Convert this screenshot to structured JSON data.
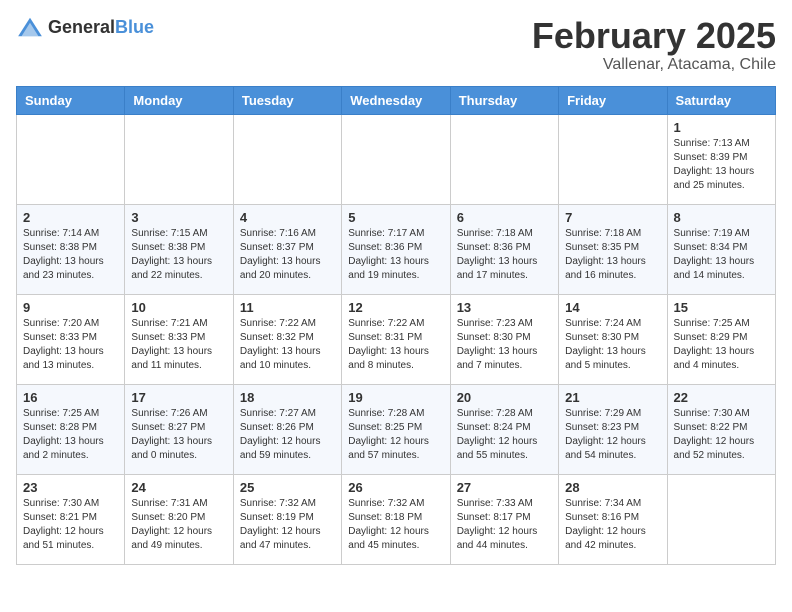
{
  "header": {
    "logo_general": "General",
    "logo_blue": "Blue",
    "month_year": "February 2025",
    "location": "Vallenar, Atacama, Chile"
  },
  "weekdays": [
    "Sunday",
    "Monday",
    "Tuesday",
    "Wednesday",
    "Thursday",
    "Friday",
    "Saturday"
  ],
  "weeks": [
    [
      {
        "day": "",
        "info": ""
      },
      {
        "day": "",
        "info": ""
      },
      {
        "day": "",
        "info": ""
      },
      {
        "day": "",
        "info": ""
      },
      {
        "day": "",
        "info": ""
      },
      {
        "day": "",
        "info": ""
      },
      {
        "day": "1",
        "info": "Sunrise: 7:13 AM\nSunset: 8:39 PM\nDaylight: 13 hours and 25 minutes."
      }
    ],
    [
      {
        "day": "2",
        "info": "Sunrise: 7:14 AM\nSunset: 8:38 PM\nDaylight: 13 hours and 23 minutes."
      },
      {
        "day": "3",
        "info": "Sunrise: 7:15 AM\nSunset: 8:38 PM\nDaylight: 13 hours and 22 minutes."
      },
      {
        "day": "4",
        "info": "Sunrise: 7:16 AM\nSunset: 8:37 PM\nDaylight: 13 hours and 20 minutes."
      },
      {
        "day": "5",
        "info": "Sunrise: 7:17 AM\nSunset: 8:36 PM\nDaylight: 13 hours and 19 minutes."
      },
      {
        "day": "6",
        "info": "Sunrise: 7:18 AM\nSunset: 8:36 PM\nDaylight: 13 hours and 17 minutes."
      },
      {
        "day": "7",
        "info": "Sunrise: 7:18 AM\nSunset: 8:35 PM\nDaylight: 13 hours and 16 minutes."
      },
      {
        "day": "8",
        "info": "Sunrise: 7:19 AM\nSunset: 8:34 PM\nDaylight: 13 hours and 14 minutes."
      }
    ],
    [
      {
        "day": "9",
        "info": "Sunrise: 7:20 AM\nSunset: 8:33 PM\nDaylight: 13 hours and 13 minutes."
      },
      {
        "day": "10",
        "info": "Sunrise: 7:21 AM\nSunset: 8:33 PM\nDaylight: 13 hours and 11 minutes."
      },
      {
        "day": "11",
        "info": "Sunrise: 7:22 AM\nSunset: 8:32 PM\nDaylight: 13 hours and 10 minutes."
      },
      {
        "day": "12",
        "info": "Sunrise: 7:22 AM\nSunset: 8:31 PM\nDaylight: 13 hours and 8 minutes."
      },
      {
        "day": "13",
        "info": "Sunrise: 7:23 AM\nSunset: 8:30 PM\nDaylight: 13 hours and 7 minutes."
      },
      {
        "day": "14",
        "info": "Sunrise: 7:24 AM\nSunset: 8:30 PM\nDaylight: 13 hours and 5 minutes."
      },
      {
        "day": "15",
        "info": "Sunrise: 7:25 AM\nSunset: 8:29 PM\nDaylight: 13 hours and 4 minutes."
      }
    ],
    [
      {
        "day": "16",
        "info": "Sunrise: 7:25 AM\nSunset: 8:28 PM\nDaylight: 13 hours and 2 minutes."
      },
      {
        "day": "17",
        "info": "Sunrise: 7:26 AM\nSunset: 8:27 PM\nDaylight: 13 hours and 0 minutes."
      },
      {
        "day": "18",
        "info": "Sunrise: 7:27 AM\nSunset: 8:26 PM\nDaylight: 12 hours and 59 minutes."
      },
      {
        "day": "19",
        "info": "Sunrise: 7:28 AM\nSunset: 8:25 PM\nDaylight: 12 hours and 57 minutes."
      },
      {
        "day": "20",
        "info": "Sunrise: 7:28 AM\nSunset: 8:24 PM\nDaylight: 12 hours and 55 minutes."
      },
      {
        "day": "21",
        "info": "Sunrise: 7:29 AM\nSunset: 8:23 PM\nDaylight: 12 hours and 54 minutes."
      },
      {
        "day": "22",
        "info": "Sunrise: 7:30 AM\nSunset: 8:22 PM\nDaylight: 12 hours and 52 minutes."
      }
    ],
    [
      {
        "day": "23",
        "info": "Sunrise: 7:30 AM\nSunset: 8:21 PM\nDaylight: 12 hours and 51 minutes."
      },
      {
        "day": "24",
        "info": "Sunrise: 7:31 AM\nSunset: 8:20 PM\nDaylight: 12 hours and 49 minutes."
      },
      {
        "day": "25",
        "info": "Sunrise: 7:32 AM\nSunset: 8:19 PM\nDaylight: 12 hours and 47 minutes."
      },
      {
        "day": "26",
        "info": "Sunrise: 7:32 AM\nSunset: 8:18 PM\nDaylight: 12 hours and 45 minutes."
      },
      {
        "day": "27",
        "info": "Sunrise: 7:33 AM\nSunset: 8:17 PM\nDaylight: 12 hours and 44 minutes."
      },
      {
        "day": "28",
        "info": "Sunrise: 7:34 AM\nSunset: 8:16 PM\nDaylight: 12 hours and 42 minutes."
      },
      {
        "day": "",
        "info": ""
      }
    ]
  ]
}
